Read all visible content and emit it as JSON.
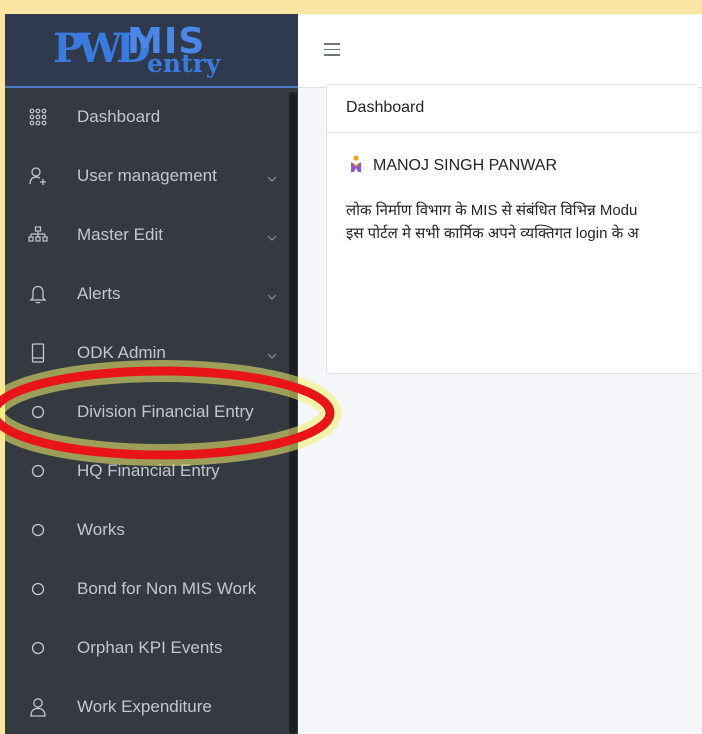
{
  "brand": {
    "logo_pwd": "PWD",
    "logo_mis": "MIS",
    "logo_entry": "entry"
  },
  "sidebar": {
    "items": [
      {
        "label": "Dashboard",
        "icon": "grid-icon",
        "has_chevron": false
      },
      {
        "label": "User management",
        "icon": "user-plus-icon",
        "has_chevron": true
      },
      {
        "label": "Master Edit",
        "icon": "sitemap-icon",
        "has_chevron": true
      },
      {
        "label": "Alerts",
        "icon": "bell-icon",
        "has_chevron": true
      },
      {
        "label": "ODK Admin",
        "icon": "mobile-icon",
        "has_chevron": true
      },
      {
        "label": "Division Financial Entry",
        "icon": "circle-icon",
        "has_chevron": false
      },
      {
        "label": "HQ Financial Entry",
        "icon": "circle-icon",
        "has_chevron": false
      },
      {
        "label": "Works",
        "icon": "circle-icon",
        "has_chevron": false
      },
      {
        "label": "Bond for Non MIS Work",
        "icon": "circle-icon",
        "has_chevron": false
      },
      {
        "label": "Orphan KPI Events",
        "icon": "circle-icon",
        "has_chevron": false
      },
      {
        "label": "Work Expenditure",
        "icon": "user-icon",
        "has_chevron": false
      }
    ]
  },
  "topbar": {
    "menu_icon": "hamburger-icon"
  },
  "card": {
    "title": "Dashboard",
    "user_name": "MANOJ SINGH PANWAR",
    "user_icon": "person-icon",
    "line1": "लोक निर्माण विभाग के MIS से संबंधित विभिन्न Modu",
    "line2": "इस पोर्टल मे सभी कार्मिक अपने व्यक्तिगत login के अ"
  },
  "colors": {
    "sidebar_bg": "#343a40",
    "brand_bg": "#2f3a4f",
    "accent": "#4a87e8",
    "annotation_red": "#e8141a",
    "annotation_glow": "#f4f06a",
    "page_border": "#fce6a6"
  }
}
